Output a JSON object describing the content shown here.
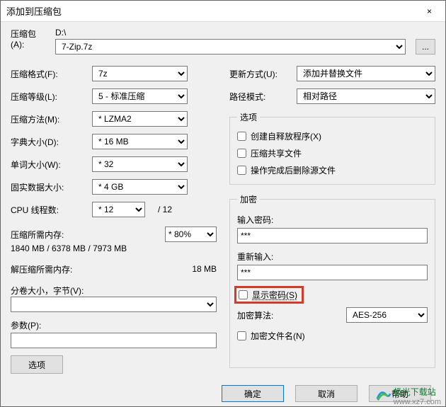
{
  "window": {
    "title": "添加到压缩包",
    "close": "×"
  },
  "archive": {
    "label": "压缩包(A):",
    "path": "D:\\",
    "filename": "7-Zip.7z",
    "browse": "..."
  },
  "left": {
    "format": {
      "label": "压缩格式(F):",
      "value": "7z"
    },
    "level": {
      "label": "压缩等级(L):",
      "value": "5 - 标准压缩"
    },
    "method": {
      "label": "压缩方法(M):",
      "value": "* LZMA2"
    },
    "dict": {
      "label": "字典大小(D):",
      "value": "* 16 MB"
    },
    "word": {
      "label": "单词大小(W):",
      "value": "* 32"
    },
    "solid": {
      "label": "固实数据大小:",
      "value": "* 4 GB"
    },
    "threads": {
      "label": "CPU 线程数:",
      "value": "* 12",
      "suffix": "/ 12"
    },
    "mem_comp": {
      "label": "压缩所需内存:",
      "pct": "* 80%",
      "value": "1840 MB / 6378 MB / 7973 MB"
    },
    "mem_decomp": {
      "label": "解压缩所需内存:",
      "value": "18 MB"
    },
    "volume": {
      "label": "分卷大小，字节(V):",
      "value": ""
    },
    "params": {
      "label": "参数(P):",
      "value": ""
    },
    "options_btn": "选项"
  },
  "right": {
    "update": {
      "label": "更新方式(U):",
      "value": "添加并替换文件"
    },
    "pathmode": {
      "label": "路径模式:",
      "value": "相对路径"
    },
    "options": {
      "legend": "选项",
      "sfx": "创建自释放程序(X)",
      "shared": "压缩共享文件",
      "delete_after": "操作完成后删除源文件"
    },
    "encryption": {
      "legend": "加密",
      "pass1_label": "输入密码:",
      "pass1_value": "***",
      "pass2_label": "重新输入:",
      "pass2_value": "***",
      "show_pwd": "显示密码(S)",
      "method_label": "加密算法:",
      "method_value": "AES-256",
      "encrypt_names": "加密文件名(N)"
    }
  },
  "footer": {
    "ok": "确定",
    "cancel": "取消",
    "help": "帮助"
  },
  "watermark": {
    "brand": "极光下载站",
    "url": "www.xz7.com"
  }
}
